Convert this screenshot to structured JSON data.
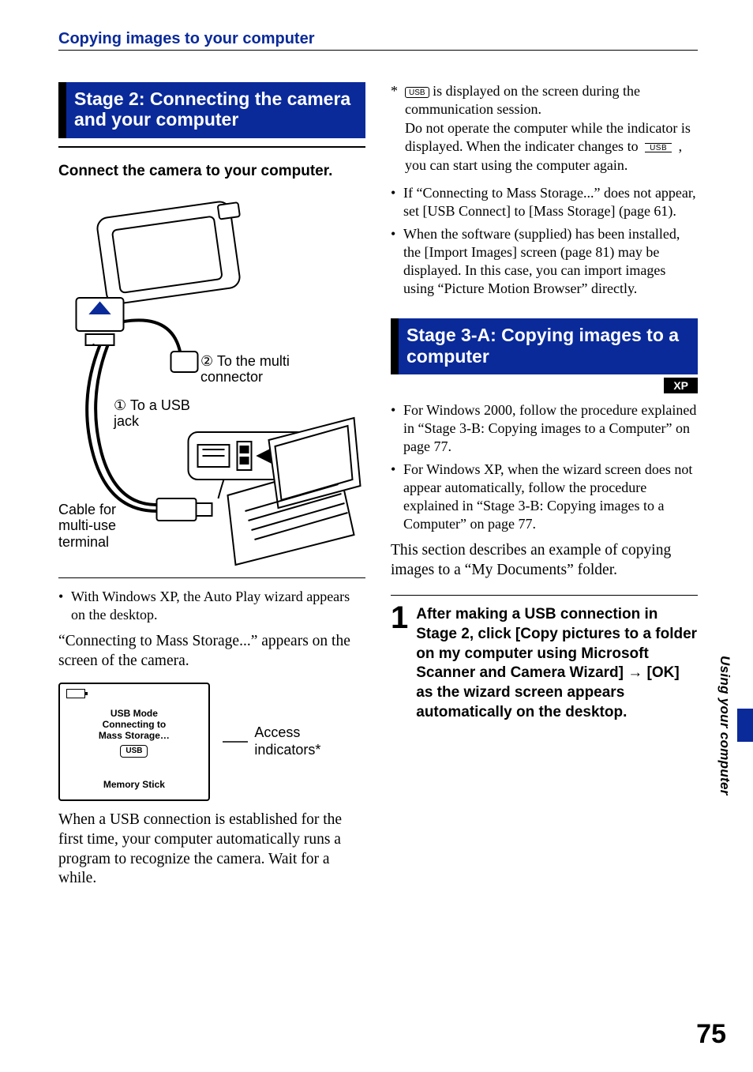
{
  "running_head": "Copying images to your computer",
  "side_tab": "Using your computer",
  "page_number": "75",
  "left": {
    "stage_title": "Stage 2: Connecting the camera and your computer",
    "connect_heading": "Connect the camera to your computer.",
    "fig": {
      "callout_multi": "② To the multi connector",
      "callout_usb": "① To a USB jack",
      "callout_cable": "Cable for multi-use terminal"
    },
    "bullet1": "With Windows XP, the Auto Play wizard appears on the desktop.",
    "para_connecting": "“Connecting to Mass Storage...” appears on the screen of the camera.",
    "screen": {
      "line1": "USB Mode",
      "line2": "Connecting to",
      "line3": "Mass Storage…",
      "usb_badge": "USB",
      "ms": "Memory Stick"
    },
    "access_label": "Access indicators*",
    "para_established": "When a USB connection is established for the first time, your computer automatically runs a program to recognize the camera. Wait for a while."
  },
  "right": {
    "star_note_part1": " is displayed on the screen during the communication session.",
    "star_note_part2": "Do not operate the computer while the indicator is displayed. When the indicater changes to ",
    "star_note_part3": " , you can start using the computer again.",
    "bullets": [
      "If “Connecting to Mass Storage...” does not appear, set [USB Connect] to [Mass Storage] (page 61).",
      "When the software (supplied) has been installed, the [Import Images] screen (page 81) may be displayed. In this case, you can import images using “Picture Motion Browser” directly."
    ],
    "stage_title": "Stage 3-A: Copying images to a computer",
    "xp": "XP",
    "bullets2": [
      "For Windows 2000, follow the procedure explained in “Stage 3-B: Copying images to a Computer” on page 77.",
      "For Windows XP, when the wizard screen does not appear automatically, follow the procedure explained in “Stage 3-B: Copying images to a Computer” on page 77."
    ],
    "para_intro": "This section describes an example of copying images to a “My Documents” folder.",
    "step1_num": "1",
    "step1_text": "After making a USB connection in Stage 2, click [Copy pictures to a folder on my computer using Microsoft Scanner and Camera Wizard] → [OK] as the wizard screen appears automatically on the desktop."
  }
}
